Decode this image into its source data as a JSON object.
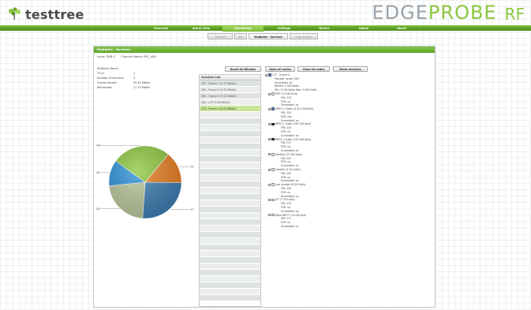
{
  "header": {
    "logo_text": "testtree",
    "brand_edge": "EDGE",
    "brand_probe": "PROBE",
    "brand_rf": "RF"
  },
  "nav": [
    {
      "label": "Overview",
      "active": false
    },
    {
      "label": "Alarm View",
      "active": false
    },
    {
      "label": "Monitoring",
      "active": true
    },
    {
      "label": "Settings",
      "active": false
    },
    {
      "label": "Device",
      "active": false
    },
    {
      "label": "Admin",
      "active": false
    },
    {
      "label": "About",
      "active": false
    }
  ],
  "subtabs": [
    {
      "label": "Channel",
      "active": false
    },
    {
      "label": "QoS",
      "active": false
    },
    {
      "label": "Multiplex - Services",
      "active": true
    },
    {
      "label": "Logs Events",
      "active": false
    }
  ],
  "panel": {
    "title": "Multiplex - Services",
    "input_label": "Input: DVB-C",
    "channel_label": "Channel Name: RFC_480",
    "info": [
      {
        "label": "Multiplex Name:",
        "value": ""
      },
      {
        "label": "TS Id:",
        "value": "1"
      },
      {
        "label": "Number of Services:",
        "value": "5"
      },
      {
        "label": "Overall bitrate:",
        "value": "25.34 Mbit/s"
      },
      {
        "label": "Net bitrate:",
        "value": "21.10 Mbit/s"
      }
    ]
  },
  "chart_data": {
    "type": "pie",
    "categories": [
      "257",
      "273",
      "262",
      "261",
      "260"
    ],
    "values": [
      2.77,
      5.03,
      4.32,
      2.25,
      5.06
    ],
    "colors": [
      "#e67e22",
      "#3c7cb0",
      "#b9c49a",
      "#2b8fd6",
      "#8dc63f"
    ],
    "labels": [
      "257",
      "273",
      "262",
      "261",
      "260"
    ]
  },
  "buttons": {
    "reset_bitrates": "Reset All Bitrates",
    "open_nodes": "Open all nodes",
    "close_nodes": "Close all nodes",
    "reset_minmax": "Reset min/max"
  },
  "services": {
    "header": "Services List",
    "items": [
      {
        "label": "257 - France 2 (2.77 Mbit/s)",
        "selected": false
      },
      {
        "label": "260 - France 5 (4.32 Mbit/s)",
        "selected": false
      },
      {
        "label": "261 - France O (2.25 Mbit/s)",
        "selected": false
      },
      {
        "label": "262 - LCP (5.06 Mbit/s)",
        "selected": false
      },
      {
        "label": "273 - France 3 (5.03 Mbit/s)",
        "selected": true
      }
    ],
    "empty_rows": 30
  },
  "tree": {
    "root": "272 - France 3",
    "root_details": [
      "Provider name: GR1",
      "Scrambled: no",
      "Bitrate: 5 026 kbit/s",
      "Min: 5 018 kbit/s   Max: 5 029 kbit/s"
    ],
    "nodes": [
      {
        "label": "PMT (15 040 bit/s)",
        "icon": "file",
        "details": [
          "PID: 210",
          "PCR: no",
          "Scrambled: no"
        ]
      },
      {
        "label": "MPEG-2 Video (4 312 006 bit/s)",
        "icon": "tv",
        "details": [
          "PID: 220",
          "PCR: yes",
          "Scrambled: no"
        ]
      },
      {
        "label": "MPEG-1 Audio (199 526 bit/s)",
        "icon": "spk",
        "details": [
          "PID: 230",
          "PCR: no",
          "Scrambled: no"
        ]
      },
      {
        "label": "MPEG-1 Audio (199 526 bit/s)",
        "icon": "spk",
        "details": [
          "PID: 231",
          "PCR: no",
          "Scrambled: no"
        ]
      },
      {
        "label": "Teletext (75 300 bit/s)",
        "icon": "file",
        "details": [
          "PID: 241",
          "PCR: no",
          "Scrambled: no"
        ]
      },
      {
        "label": "Subtitle (4 512 bit/s)",
        "icon": "file",
        "details": [
          "PID: 242",
          "PCR: no",
          "Scrambled: no"
        ]
      },
      {
        "label": "user private (6 016 bit/s)",
        "icon": "file",
        "details": [
          "PID: 250",
          "PCR: no",
          "Scrambled: no"
        ]
      },
      {
        "label": "AIT (7 520 bit/s)",
        "icon": "file",
        "details": [
          "PID: 270",
          "PCR: no",
          "Scrambled: no"
        ]
      },
      {
        "label": "Data MHP?+ (6 016 bit/s)",
        "icon": "file",
        "details": [
          "PID: 271",
          "PCR: no",
          "Scrambled: no"
        ]
      }
    ]
  }
}
